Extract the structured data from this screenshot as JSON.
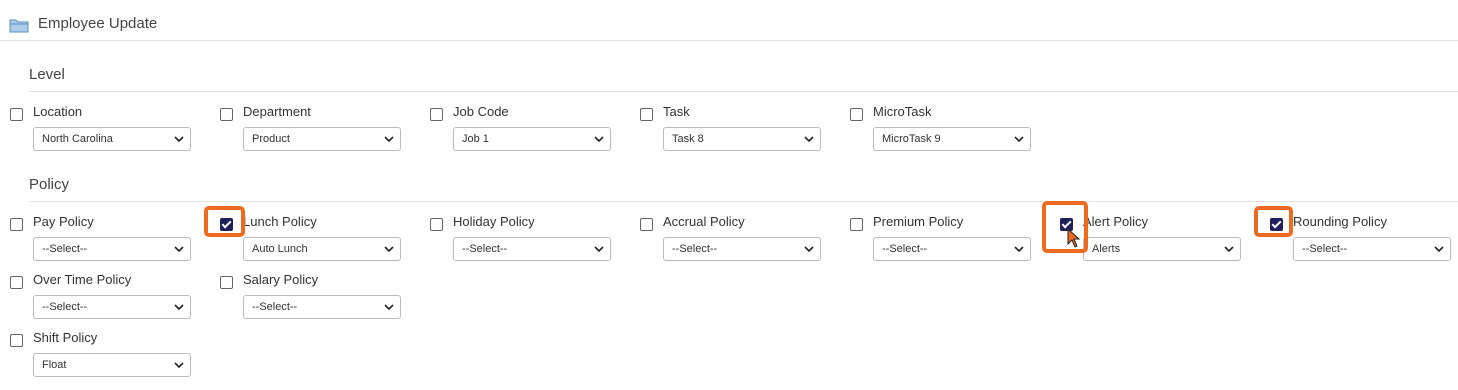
{
  "header": {
    "title": "Employee Update",
    "icon": "folder-icon"
  },
  "accent": "#ee6a1f",
  "level": {
    "title": "Level",
    "fields": [
      {
        "label": "Location",
        "checked": false,
        "value": "North Carolina"
      },
      {
        "label": "Department",
        "checked": false,
        "value": "Product"
      },
      {
        "label": "Job Code",
        "checked": false,
        "value": "Job 1"
      },
      {
        "label": "Task",
        "checked": false,
        "value": "Task 8"
      },
      {
        "label": "MicroTask",
        "checked": false,
        "value": "MicroTask 9"
      }
    ]
  },
  "policy": {
    "title": "Policy",
    "fields": [
      {
        "label": "Pay Policy",
        "checked": false,
        "value": "--Select--"
      },
      {
        "label": "Lunch Policy",
        "checked": true,
        "value": "Auto Lunch"
      },
      {
        "label": "Holiday Policy",
        "checked": false,
        "value": "--Select--"
      },
      {
        "label": "Accrual Policy",
        "checked": false,
        "value": "--Select--"
      },
      {
        "label": "Premium Policy",
        "checked": false,
        "value": "--Select--"
      },
      {
        "label": "Alert Policy",
        "checked": true,
        "value": "Alerts"
      },
      {
        "label": "Rounding Policy",
        "checked": true,
        "value": "--Select--"
      },
      {
        "label": "Over Time Policy",
        "checked": false,
        "value": "--Select--"
      },
      {
        "label": "Salary Policy",
        "checked": false,
        "value": "--Select--"
      },
      {
        "label": "Shift Policy",
        "checked": false,
        "value": "Float"
      }
    ]
  }
}
